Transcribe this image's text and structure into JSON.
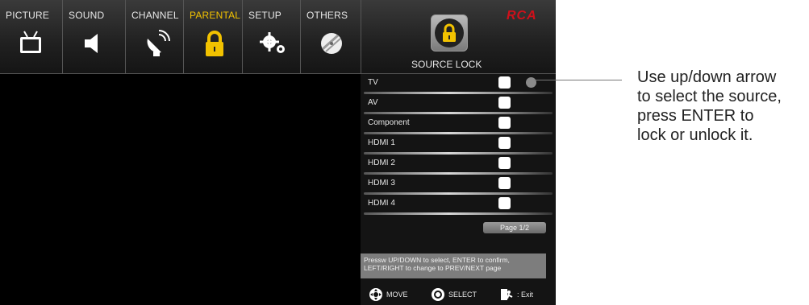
{
  "menu": {
    "tabs": [
      {
        "label": "PICTURE",
        "icon": "tv-icon"
      },
      {
        "label": "SOUND",
        "icon": "speaker-icon"
      },
      {
        "label": "CHANNEL",
        "icon": "satellite-dish-icon"
      },
      {
        "label": "PARENTAL",
        "icon": "padlock-icon",
        "active": true
      },
      {
        "label": "SETUP",
        "icon": "gears-icon"
      },
      {
        "label": "OTHERS",
        "icon": "disc-icon"
      }
    ],
    "active_color": "#f2c200",
    "brand_logo": "RCA",
    "brand_color": "#d0101a"
  },
  "header": {
    "title": "SOURCE LOCK",
    "icon": "padlock-icon"
  },
  "sources": [
    {
      "label": "TV",
      "selected": true
    },
    {
      "label": "AV"
    },
    {
      "label": "Component"
    },
    {
      "label": "HDMI 1"
    },
    {
      "label": "HDMI 2"
    },
    {
      "label": "HDMI 3"
    },
    {
      "label": "HDMI 4"
    }
  ],
  "page_label": "Page 1/2",
  "help_text": {
    "line1": "Pressw UP/DOWN to select, ENTER to confirm,",
    "line2": "LEFT/RIGHT to change to PREV/NEXT page"
  },
  "controls": {
    "move": "MOVE",
    "select": "SELECT",
    "exit": ": Exit"
  },
  "callout": {
    "line1": "Use up/down arrow",
    "line2": "to select the source,",
    "line3": "press ENTER to",
    "line4": "lock or unlock it."
  }
}
